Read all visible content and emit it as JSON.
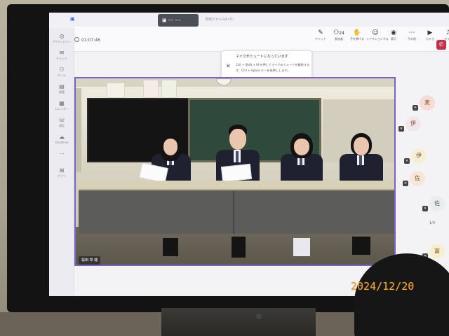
{
  "topbar": {
    "meeting_title": "--- ---",
    "search_hint": "検索(Ctrl+Alt+E)"
  },
  "rail": [
    {
      "glyph": "◎",
      "label": "アクティビティ"
    },
    {
      "glyph": "✉",
      "label": "チャット"
    },
    {
      "glyph": "⚇",
      "label": "チーム"
    },
    {
      "glyph": "▤",
      "label": "課題"
    },
    {
      "glyph": "▦",
      "label": "カレンダー"
    },
    {
      "glyph": "☏",
      "label": "通話"
    },
    {
      "glyph": "☁",
      "label": "OneDrive"
    },
    {
      "glyph": "⋯",
      "label": ""
    },
    {
      "glyph": "⊞",
      "label": "アプリ"
    }
  ],
  "toolbar": {
    "timer": "01:07:46",
    "tools": [
      {
        "glyph": "✎",
        "label": "チャット"
      },
      {
        "glyph": "⚇",
        "label": "参加者",
        "count": "24"
      },
      {
        "glyph": "✋",
        "label": "手を挙げる"
      },
      {
        "glyph": "☺",
        "label": "リアクションする"
      },
      {
        "glyph": "◉",
        "label": "表示"
      },
      {
        "glyph": "⋯",
        "label": "その他"
      },
      {
        "glyph": "▶",
        "label": "カメラ"
      },
      {
        "glyph": "♪",
        "label": "マイク"
      },
      {
        "glyph": "▲",
        "label": "共有"
      }
    ],
    "leave_glyph": "✆"
  },
  "toast": {
    "title": "マイクがミュートになっています",
    "body": "Ctrl + Shift + M を押してマイクのミュートを解除するか、Ctrl + Space キーを長押しします。"
  },
  "video": {
    "nameplate": "桜田 草 瑞"
  },
  "side_panel": {
    "avatars": [
      {
        "initial": "麦",
        "color": "#f6dcd6"
      },
      {
        "initial": "伊",
        "color": "#f3e5ec"
      },
      {
        "initial": "伊",
        "color": "#f5eed6"
      },
      {
        "initial": "佐",
        "color": "#f7e6da"
      },
      {
        "initial": "佐",
        "color": "#e6eef2"
      },
      {
        "initial": "富",
        "color": "#f5efd0"
      }
    ],
    "pager": "1/3"
  },
  "photo_stamp": "2024/12/20",
  "colors": {
    "accent": "#7a62c9",
    "leave": "#c4314b",
    "stamp": "#f2a534"
  }
}
